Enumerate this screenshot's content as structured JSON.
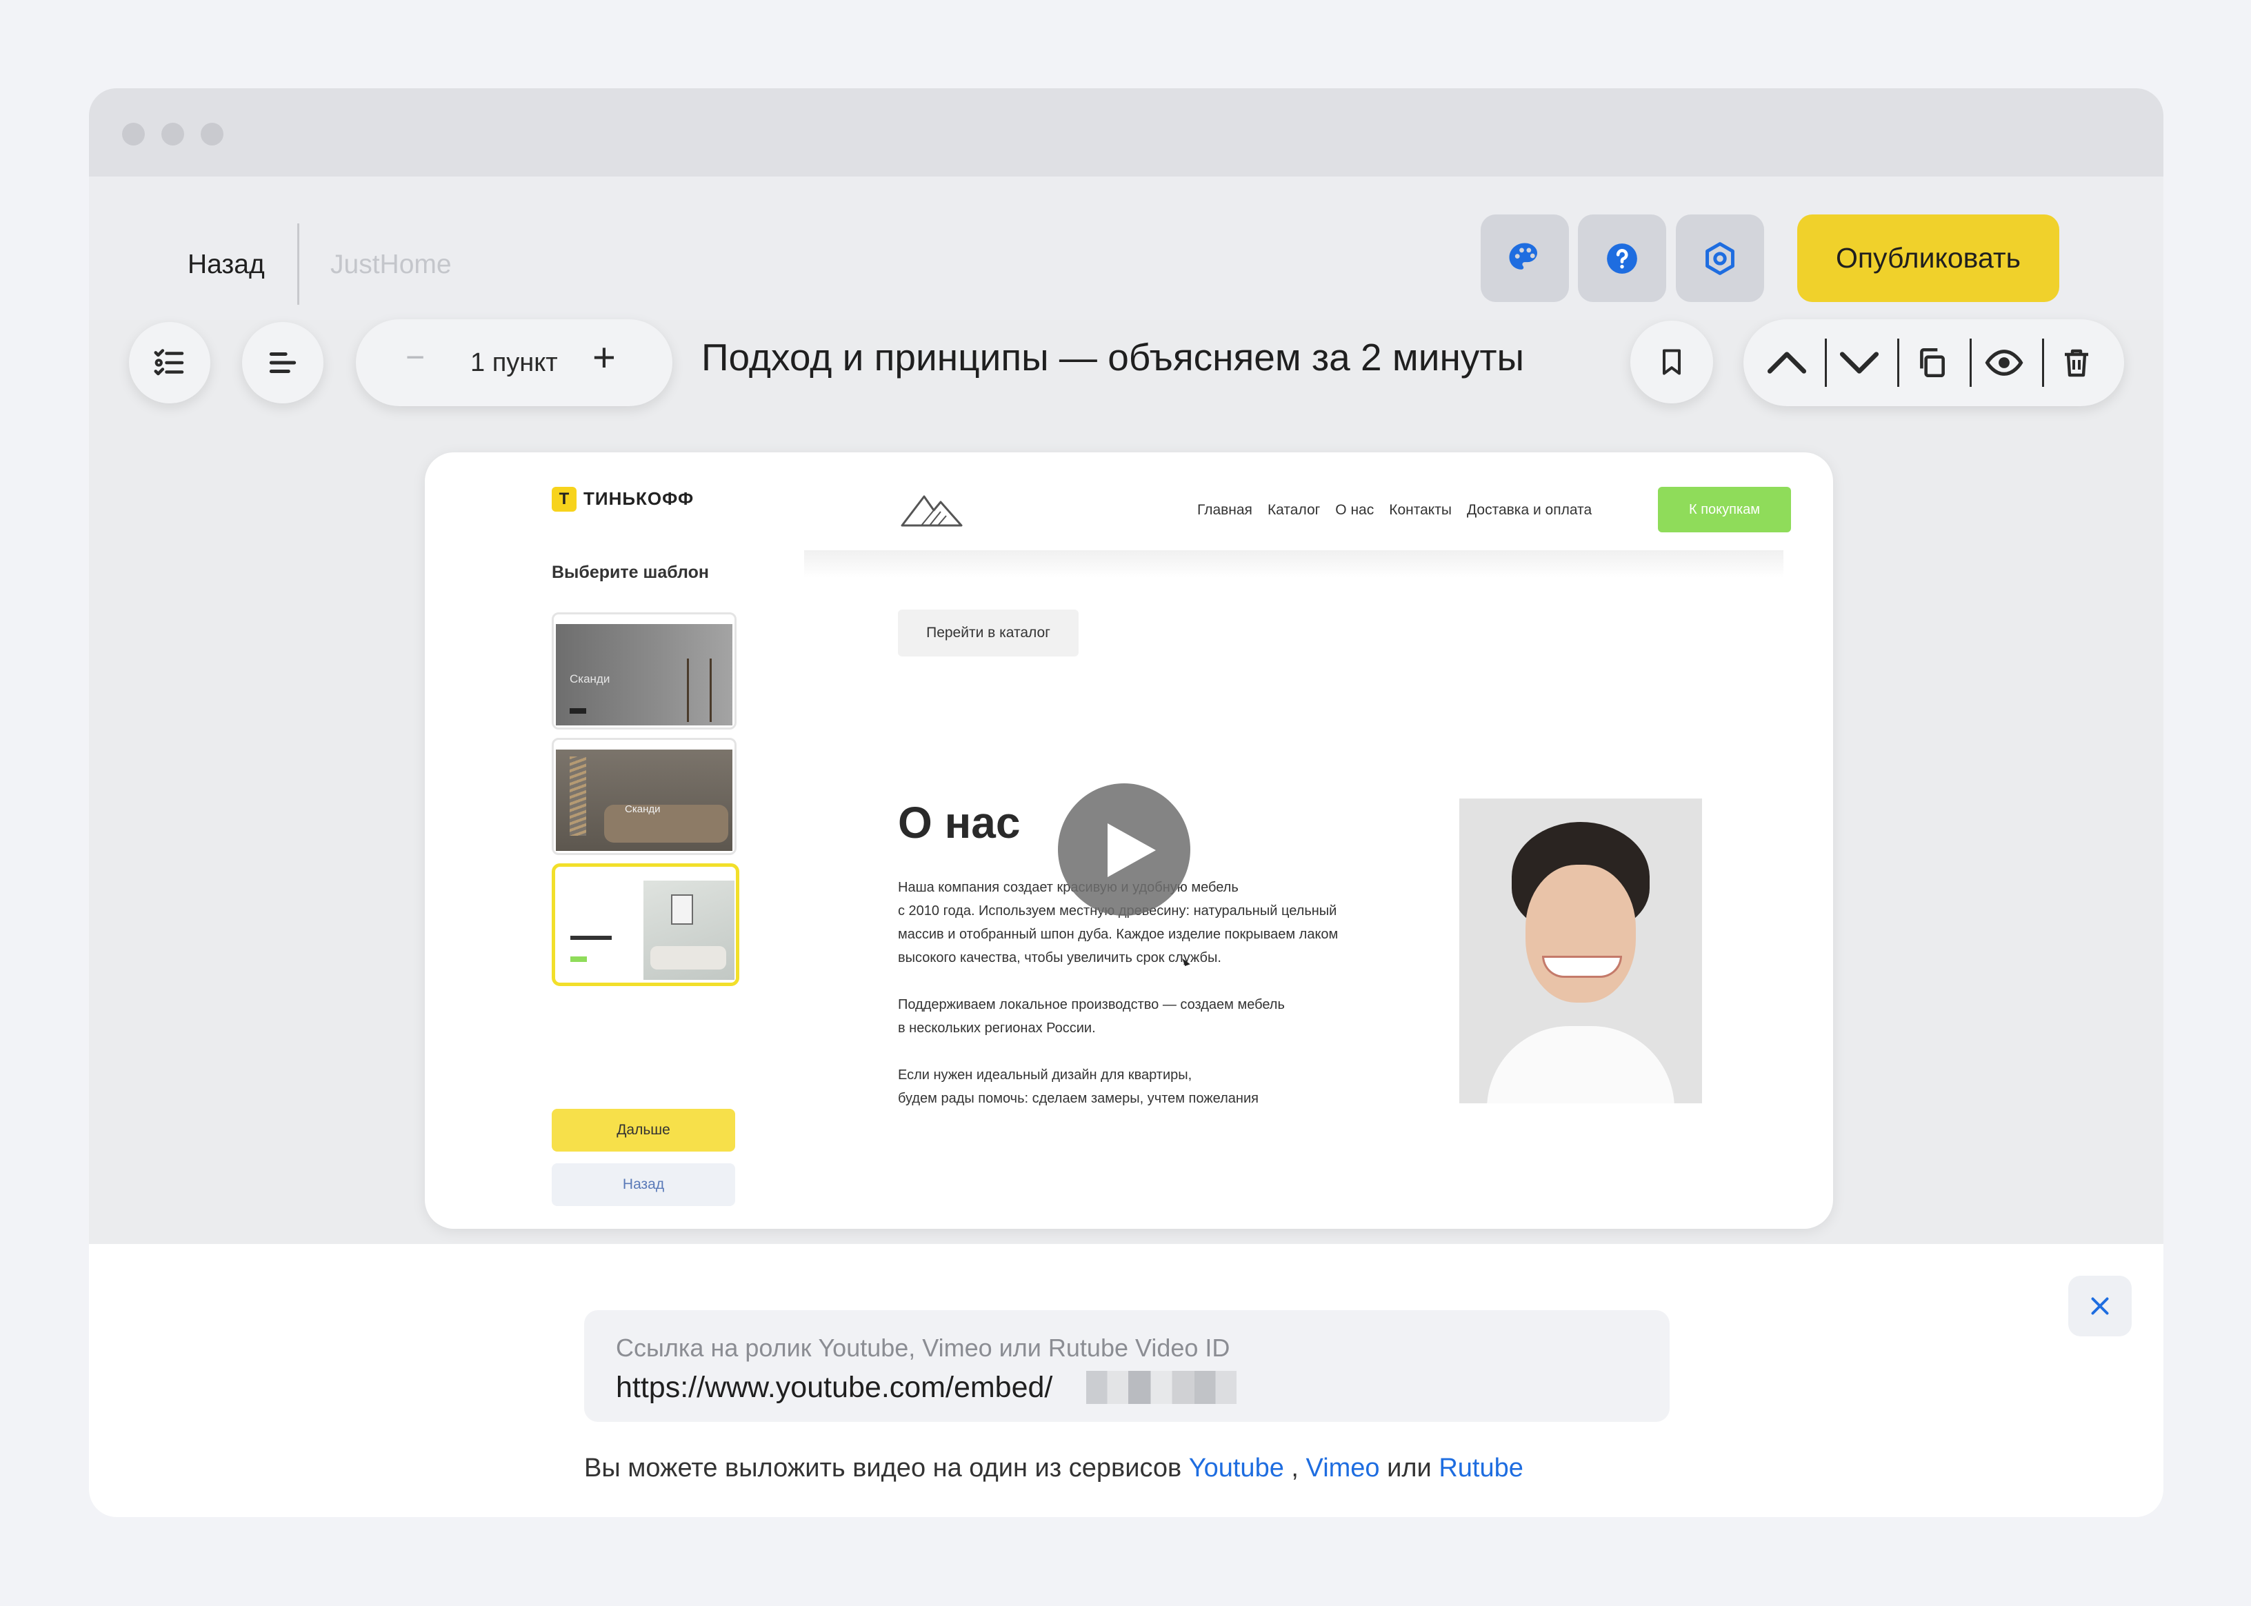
{
  "toolbar": {
    "back_label": "Назад",
    "site_name": "JustHome",
    "publish_label": "Опубликовать",
    "icons": [
      "palette-icon",
      "help-icon",
      "settings-icon"
    ]
  },
  "block": {
    "items_count": "1 пункт",
    "title": "Подход и принципы — объясняем за 2 минуты"
  },
  "video_preview": {
    "brand": "ТИНЬКОФФ",
    "brand_letter": "T",
    "choose_template": "Выберите шаблон",
    "template_captions": [
      "Сканди",
      "Сканди"
    ],
    "next_button": "Дальше",
    "back_button": "Назад",
    "site_nav": [
      "Главная",
      "Каталог",
      "О нас",
      "Контакты",
      "Доставка и оплата"
    ],
    "shop_button": "К покупкам",
    "catalog_button": "Перейти в каталог",
    "about_heading": "О нас",
    "paragraphs": [
      [
        "Наша компания создает красивую и удобную мебель",
        "с 2010 года. Используем местную древесину: натуральный цельный",
        "массив и отобранный шпон дуба. Каждое изделие покрываем лаком",
        "высокого качества, чтобы увеличить срок службы."
      ],
      [
        "Поддерживаем локальное производство — создаем мебель",
        "в нескольких регионах России."
      ],
      [
        "Если нужен идеальный дизайн для квартиры,",
        "будем рады помочь: сделаем замеры, учтем пожелания"
      ]
    ]
  },
  "video_settings": {
    "url_label": "Ссылка на ролик Youtube, Vimeo или Rutube Video ID",
    "url_value": "https://www.youtube.com/embed/",
    "hint_prefix": "Вы можете выложить видео на один из сервисов ",
    "hint_link1": "Youtube",
    "hint_sep": " , ",
    "hint_link2": "Vimeo",
    "hint_or": " или ",
    "hint_link3": "Rutube"
  },
  "colors": {
    "accent_yellow": "#f0d12b",
    "link_blue": "#1e6de0",
    "icon_blue": "#1e6de0",
    "shop_green": "#8fdc5a"
  }
}
